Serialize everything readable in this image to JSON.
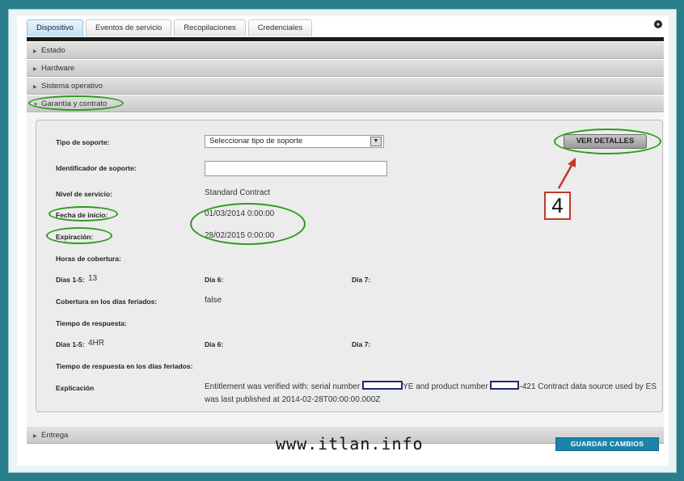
{
  "tabs": [
    "Dispositivo",
    "Eventos de servicio",
    "Recopilaciones",
    "Credenciales"
  ],
  "sections": {
    "estado": "Estado",
    "hardware": "Hardware",
    "sistema": "Sistema operativo",
    "garantia": "Garantía y contrato",
    "entrega": "Entrega"
  },
  "form": {
    "tipo_soporte_label": "Tipo de soporte:",
    "tipo_soporte_value": "Seleccionar tipo de soporte",
    "identificador_label": "Identificador de soporte:",
    "identificador_value": "",
    "nivel_label": "Nivel de servicio:",
    "nivel_value": "Standard Contract",
    "fecha_inicio_label": "Fecha de inicio:",
    "fecha_inicio_value": "01/03/2014 0:00:00",
    "expiracion_label": "Expiración:",
    "expiracion_value": "28/02/2015 0:00:00",
    "horas_label": "Horas de cobertura:",
    "dias15_label": "Días 1-5:",
    "dias15_value": "13",
    "dia6_label": "Día 6:",
    "dia7_label": "Día 7:",
    "feriados_label": "Cobertura en los días feriados:",
    "feriados_value": "false",
    "respuesta_label": "Tiempo de respuesta:",
    "resp_dias15_label": "Días 1-5:",
    "resp_dias15_value": "4HR",
    "resp_dia6_label": "Día 6:",
    "resp_dia7_label": "Día 7:",
    "resp_feriados_label": "Tiempo de respuesta en los días feriados:",
    "explicacion_label": "Explicación",
    "expl_part1": "Entitlement was verified with: serial number ",
    "expl_part2": "YE and product number ",
    "expl_part3": "-421 Contract data source used by ES was last published at 2014-02-28T00:00:00.000Z"
  },
  "buttons": {
    "ver_detalles": "VER DETALLES",
    "guardar": "GUARDAR CAMBIOS"
  },
  "annotation_number": "4",
  "watermark": "www.itlan.info",
  "colors": {
    "accent": "#1b84a8",
    "highlight_oval": "#2f9a1f",
    "callout_border": "#c0392b",
    "background": "#2a7d8c"
  }
}
